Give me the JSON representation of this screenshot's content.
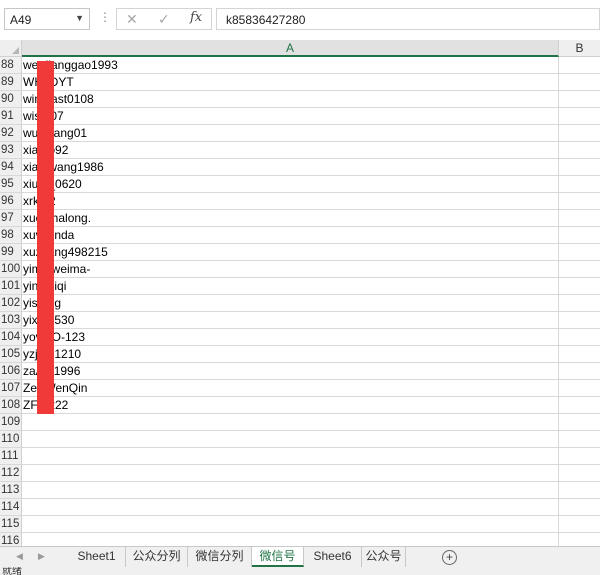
{
  "formula_bar": {
    "name_box": "A49",
    "fx_label": "fx",
    "cancel_glyph": "✕",
    "enter_glyph": "✓",
    "formula_value": "k85836427280"
  },
  "columns": [
    "A",
    "B"
  ],
  "rows": [
    {
      "num": "88",
      "a": "we   -lianggao1993"
    },
    {
      "num": "89",
      "a": "WH   IDYT"
    },
    {
      "num": "90",
      "a": "win   east0108"
    },
    {
      "num": "91",
      "a": "wis   007"
    },
    {
      "num": "92",
      "a": "wu   gliang01"
    },
    {
      "num": "93",
      "a": "xia   uo92"
    },
    {
      "num": "94",
      "a": "xia   owang1986"
    },
    {
      "num": "95",
      "a": "xiu   n_0620"
    },
    {
      "num": "96",
      "a": "xrk   12"
    },
    {
      "num": "97",
      "a": "xue   shalong."
    },
    {
      "num": "98",
      "a": "xuv   -linda"
    },
    {
      "num": "99",
      "a": "xuz   iang498215"
    },
    {
      "num": "100",
      "a": "yim   gweima-"
    },
    {
      "num": "101",
      "a": "yin   veiqi"
    },
    {
      "num": "102",
      "a": "yis   ong"
    },
    {
      "num": "103",
      "a": "yix   20530"
    },
    {
      "num": "104",
      "a": "yov   oO-123"
    },
    {
      "num": "105",
      "a": "yzj   231210"
    },
    {
      "num": "106",
      "a": "zaA   A1996"
    },
    {
      "num": "107",
      "a": "Zer   WenQin"
    },
    {
      "num": "108",
      "a": "ZFF   222"
    },
    {
      "num": "109",
      "a": ""
    },
    {
      "num": "110",
      "a": ""
    },
    {
      "num": "111",
      "a": ""
    },
    {
      "num": "112",
      "a": ""
    },
    {
      "num": "113",
      "a": ""
    },
    {
      "num": "114",
      "a": ""
    },
    {
      "num": "115",
      "a": ""
    },
    {
      "num": "116",
      "a": ""
    }
  ],
  "sheet_tabs": [
    {
      "label": "Sheet1",
      "active": false
    },
    {
      "label": "公众分列",
      "active": false
    },
    {
      "label": "微信分列",
      "active": false
    },
    {
      "label": "微信号",
      "active": true
    },
    {
      "label": "Sheet6",
      "active": false
    },
    {
      "label": "公众号",
      "active": false
    }
  ],
  "add_sheet_glyph": "+",
  "status_text": "就绪",
  "colors": {
    "accent": "#217346",
    "redaction": "#f03a3a"
  }
}
